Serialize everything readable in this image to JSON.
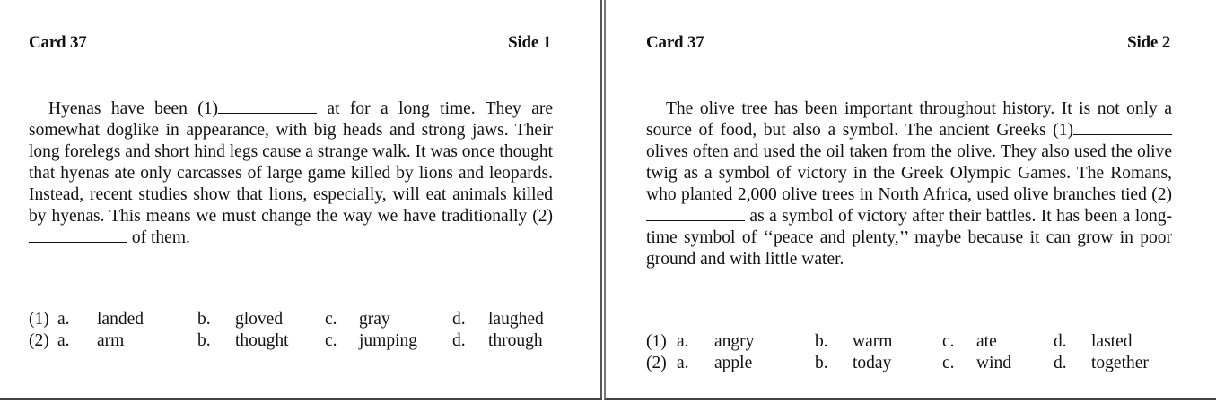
{
  "side1": {
    "card_label": "Card 37",
    "side_label": "Side 1",
    "passage": {
      "p1": "Hyenas have been (1)",
      "p2": " at for a long time. They are somewhat doglike in appearance, with big heads and strong jaws. Their long forelegs and short hind legs cause a strange walk. It was once thought that hyenas ate only carcasses of large game killed by lions and leopards. Instead, recent studies show that lions, especially, will eat animals killed by hyenas. This means we must change the way we have traditionally (2)",
      "p3": " of them."
    },
    "choices": [
      {
        "num": "(1)",
        "a": "a.",
        "a_text": "landed",
        "b": "b.",
        "b_text": "gloved",
        "c": "c.",
        "c_text": "gray",
        "d": "d.",
        "d_text": "laughed"
      },
      {
        "num": "(2)",
        "a": "a.",
        "a_text": "arm",
        "b": "b.",
        "b_text": "thought",
        "c": "c.",
        "c_text": "jumping",
        "d": "d.",
        "d_text": "through"
      }
    ]
  },
  "side2": {
    "card_label": "Card 37",
    "side_label": "Side 2",
    "passage": {
      "p1": "The olive tree has been important throughout history. It is not only a source of food, but also a symbol. The ancient Greeks (1)",
      "p2": " olives often and used the oil taken from the olive. They also used the olive twig as a symbol of victory in the Greek Olympic Games. The Romans, who planted 2,000 olive trees in North Africa, used olive branches tied (2)",
      "p3": " as a symbol of victory after their battles. It has been a long-time symbol of ‘‘peace and plenty,’’ maybe because it can grow in poor ground and with little water."
    },
    "choices": [
      {
        "num": "(1)",
        "a": "a.",
        "a_text": "angry",
        "b": "b.",
        "b_text": "warm",
        "c": "c.",
        "c_text": "ate",
        "d": "d.",
        "d_text": "lasted"
      },
      {
        "num": "(2)",
        "a": "a.",
        "a_text": "apple",
        "b": "b.",
        "b_text": "today",
        "c": "c.",
        "c_text": "wind",
        "d": "d.",
        "d_text": "together"
      }
    ]
  }
}
